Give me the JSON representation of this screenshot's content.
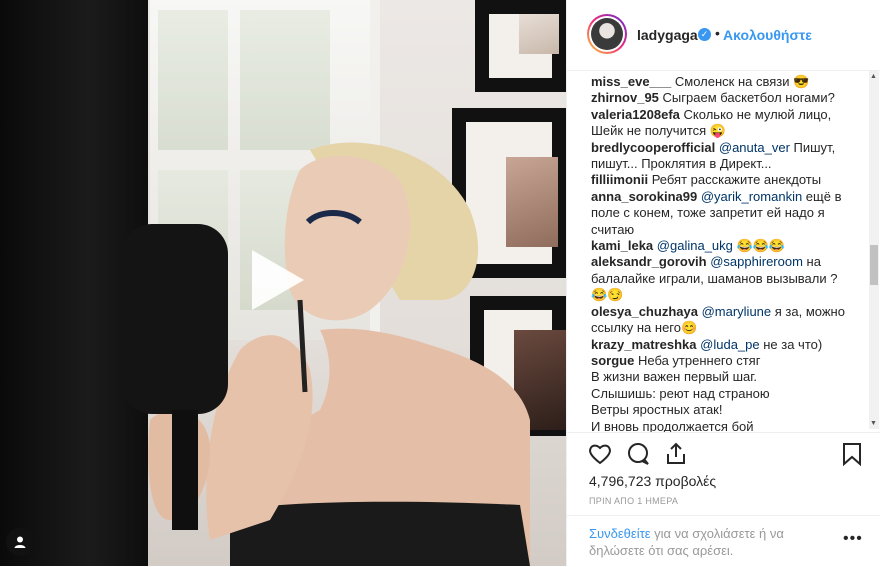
{
  "post": {
    "username": "ladygaga",
    "follow_label": "Ακολουθήστε",
    "separator": "•",
    "verified_glyph": "✓"
  },
  "comments": [
    {
      "user": "miss_eve___",
      "parts": [
        {
          "t": "text",
          "v": "Смоленск на связи 😎"
        }
      ]
    },
    {
      "user": "zhirnov_95",
      "parts": [
        {
          "t": "text",
          "v": "Сыграем баскетбол ногами?"
        }
      ]
    },
    {
      "user": "valeria1208efa",
      "parts": [
        {
          "t": "text",
          "v": "Сколько не мулюй лицо, Шейк не получится 😜"
        }
      ]
    },
    {
      "user": "bredlycooperofficial",
      "parts": [
        {
          "t": "mention",
          "v": "@anuta_ver"
        },
        {
          "t": "text",
          "v": " Пишут, пишут... Проклятия в Директ..."
        }
      ]
    },
    {
      "user": "filliimonii",
      "parts": [
        {
          "t": "text",
          "v": "Ребят расскажите анекдоты"
        }
      ]
    },
    {
      "user": "anna_sorokina99",
      "parts": [
        {
          "t": "mention",
          "v": "@yarik_romankin"
        },
        {
          "t": "text",
          "v": " ещё в поле с конем, тоже запретит ей надо я считаю"
        }
      ]
    },
    {
      "user": "kami_leka",
      "parts": [
        {
          "t": "mention",
          "v": "@galina_ukg"
        },
        {
          "t": "text",
          "v": " 😂😂😂"
        }
      ]
    },
    {
      "user": "aleksandr_gorovih",
      "parts": [
        {
          "t": "mention",
          "v": "@sapphireroom"
        },
        {
          "t": "text",
          "v": " на балалайке играли, шаманов вызывали ? 😂😏"
        }
      ]
    },
    {
      "user": "olesya_chuzhaya",
      "parts": [
        {
          "t": "mention",
          "v": "@maryliune"
        },
        {
          "t": "text",
          "v": " я за, можно ссылку на него😊"
        }
      ]
    },
    {
      "user": "krazy_matreshka",
      "parts": [
        {
          "t": "mention",
          "v": "@luda_pe"
        },
        {
          "t": "text",
          "v": " не за что)"
        }
      ]
    },
    {
      "user": "sorgue",
      "parts": [
        {
          "t": "text",
          "v": "Неба утреннего стяг\nВ жизни важен первый шаг.\nСлышишь: реют над страною\nВетры яростных атак!\nИ вновь продолжается бой"
        }
      ]
    }
  ],
  "icons": {
    "like": "heart-icon",
    "comment": "comment-icon",
    "share": "share-icon",
    "save": "bookmark-icon",
    "play": "play-icon",
    "more": "more-options-icon",
    "user": "user-tags-icon"
  },
  "stats": {
    "views": "4,796,723 προβολές",
    "time": "ΠΡΙΝ ΑΠΟ 1 ΗΜΕΡΑ"
  },
  "footer": {
    "login_link": "Συνδεθείτε",
    "login_text": " για να σχολιάσετε ή να δηλώσετε ότι σας αρέσει.",
    "more_glyph": "•••"
  },
  "colors": {
    "accent": "#3897f0",
    "text": "#262626",
    "muted": "#999999",
    "mention": "#003569"
  }
}
